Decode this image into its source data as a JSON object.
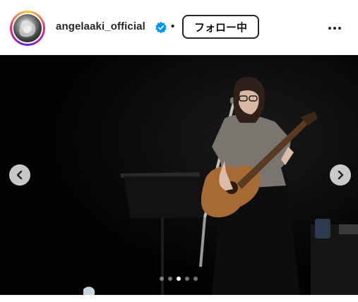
{
  "post": {
    "username": "angelaaki_official",
    "verified": true,
    "separator": "•",
    "follow_label": "フォロー中",
    "more_icon": "more-horizontal-icon",
    "verified_color": "#0095f6"
  },
  "carousel": {
    "image_count": 5,
    "active_index": 2,
    "prev_icon": "chevron-left-icon",
    "next_icon": "chevron-right-icon"
  }
}
